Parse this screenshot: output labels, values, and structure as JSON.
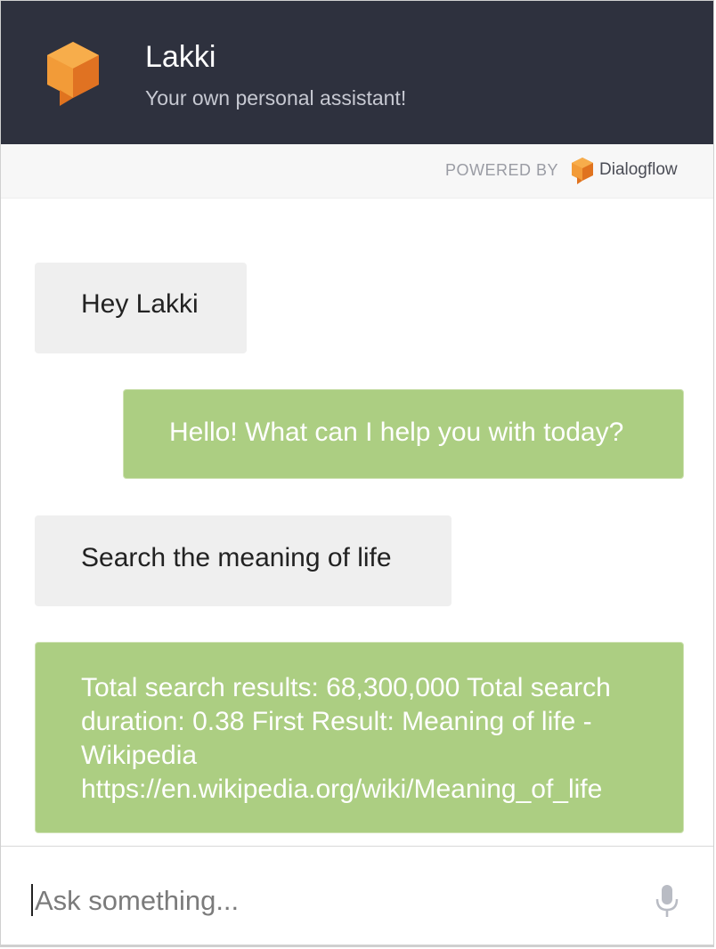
{
  "header": {
    "title": "Lakki",
    "subtitle": "Your own personal assistant!",
    "logo_icon": "dialogflow-cube-chat-icon",
    "background_color": "#2e313e"
  },
  "powered_by": {
    "label": "POWERED BY",
    "brand_icon": "dialogflow-icon",
    "brand_name": "Dialogflow"
  },
  "messages": [
    {
      "sender": "user",
      "text": "Hey Lakki"
    },
    {
      "sender": "bot",
      "text": "Hello! What can I help you with today?"
    },
    {
      "sender": "user",
      "text": "Search the meaning of life"
    },
    {
      "sender": "bot",
      "text": "Total search results: 68,300,000 Total search duration: 0.38 First Result: Meaning of life - Wikipedia https://en.wikipedia.org/wiki/Meaning_of_life"
    }
  ],
  "input": {
    "placeholder": "Ask something...",
    "value": "",
    "mic_icon": "microphone-icon"
  },
  "colors": {
    "accent_orange": "#f0892e",
    "bot_bubble": "#acce82",
    "user_bubble": "#efefef"
  }
}
